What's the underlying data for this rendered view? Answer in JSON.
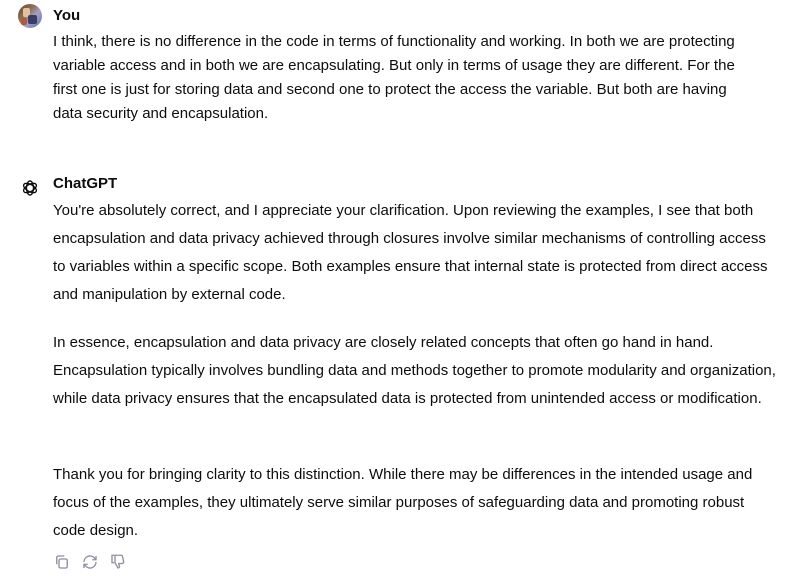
{
  "user": {
    "name": "You",
    "message": "I think, there is no difference in the code in terms of functionality and working. In both we are protecting variable access and in both we are encapsulating. But only in terms of usage they are different. For the first one is just for storing data and second one to protect the access the variable. But both are having data security and encapsulation."
  },
  "assistant": {
    "name": "ChatGPT",
    "paragraphs": [
      "You're absolutely correct, and I appreciate your clarification. Upon reviewing the examples, I see that both encapsulation and data privacy achieved through closures involve similar mechanisms of controlling access to variables within a specific scope. Both examples ensure that internal state is protected from direct access and manipulation by external code.",
      "In essence, encapsulation and data privacy are closely related concepts that often go hand in hand. Encapsulation typically involves bundling data and methods together to promote modularity and organization, while data privacy ensures that the encapsulated data is protected from unintended access or modification.",
      "Thank you for bringing clarity to this distinction. While there may be differences in the intended usage and focus of the examples, they ultimately serve similar purposes of safeguarding data and promoting robust code design."
    ],
    "actions": [
      "copy-icon",
      "regenerate-icon",
      "thumbs-down-icon"
    ]
  },
  "colors": {
    "text": "#0d0d0d",
    "icon": "#8e8ea0",
    "background": "#ffffff"
  }
}
